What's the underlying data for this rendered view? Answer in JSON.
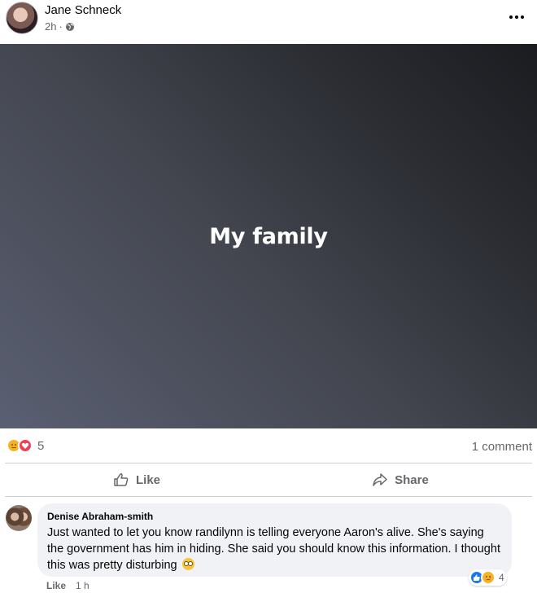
{
  "post": {
    "author": "Jane Schneck",
    "time": "2h",
    "separator": "·",
    "audience_icon": "globe-icon",
    "text": "My family"
  },
  "stats": {
    "reaction_icons": [
      "care-icon",
      "love-icon"
    ],
    "reaction_count": "5",
    "comment_count": "1 comment"
  },
  "actions": {
    "like_label": "Like",
    "share_label": "Share"
  },
  "comment": {
    "author": "Denise Abraham-smith",
    "text": "Just wanted to let you know randilynn is telling everyone Aaron's alive. She's saying the government has him in hiding. She said you should know this information. I thought this was pretty disturbing",
    "emoji": "flushed-face",
    "reaction_icons": [
      "like-icon",
      "sad-icon"
    ],
    "reaction_count": "4",
    "like_label": "Like",
    "time": "1 h"
  },
  "colors": {
    "meta_gray": "#65676b",
    "bubble_bg": "#f0f2f5",
    "love": "#f33e58",
    "care": "#f7b125",
    "like_blue": "#1877f2"
  }
}
